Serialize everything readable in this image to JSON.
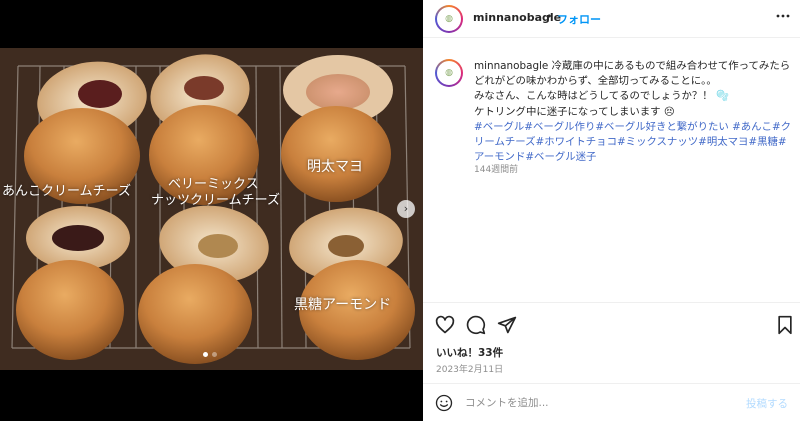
{
  "post": {
    "username": "minnanobagle",
    "separator": "•",
    "follow_label": "フォロー",
    "more_icon": "more-horizontal-icon",
    "avatar_icon": "bagle-logo-avatar"
  },
  "media": {
    "labels": {
      "anko": "あんこクリームチーズ",
      "berry_line1": "ベリーミックス",
      "berry_line2": "ナッツクリームチーズ",
      "mentai": "明太マヨ",
      "kokuto": "黒糖アーモンド"
    },
    "next_icon": "chevron-right-icon",
    "slide_count": 2,
    "active_slide": 1
  },
  "caption": {
    "username": "minnanobagle",
    "line1": "冷蔵庫の中にあるもので組み合わせて作ってみたら",
    "line2": "どれがどの味かわからず、全部切ってみることに。。",
    "line3": "みなさん、こんな時はどうしてるのでしょうか？！",
    "line4": "ケトリング中に迷子になってしまいます",
    "hashtags": [
      "#ベーグル",
      "#ベーグル作り",
      "#ベーグル好きと繋がりたい",
      "#あんこ",
      "#クリームチーズ",
      "#ホワイトチョコ",
      "#ミックスナッツ",
      "#明太マヨ",
      "#黒糖",
      "#アーモンド",
      "#ベーグル迷子"
    ],
    "time_ago": "144週間前"
  },
  "actions": {
    "like_icon": "heart-icon",
    "comment_icon": "comment-icon",
    "share_icon": "share-icon",
    "save_icon": "bookmark-icon"
  },
  "likes": "いいね！33件",
  "date": "2023年2月11日",
  "comment": {
    "placeholder": "コメントを追加...",
    "post_label": "投稿する",
    "emoji_icon": "smiley-icon"
  }
}
